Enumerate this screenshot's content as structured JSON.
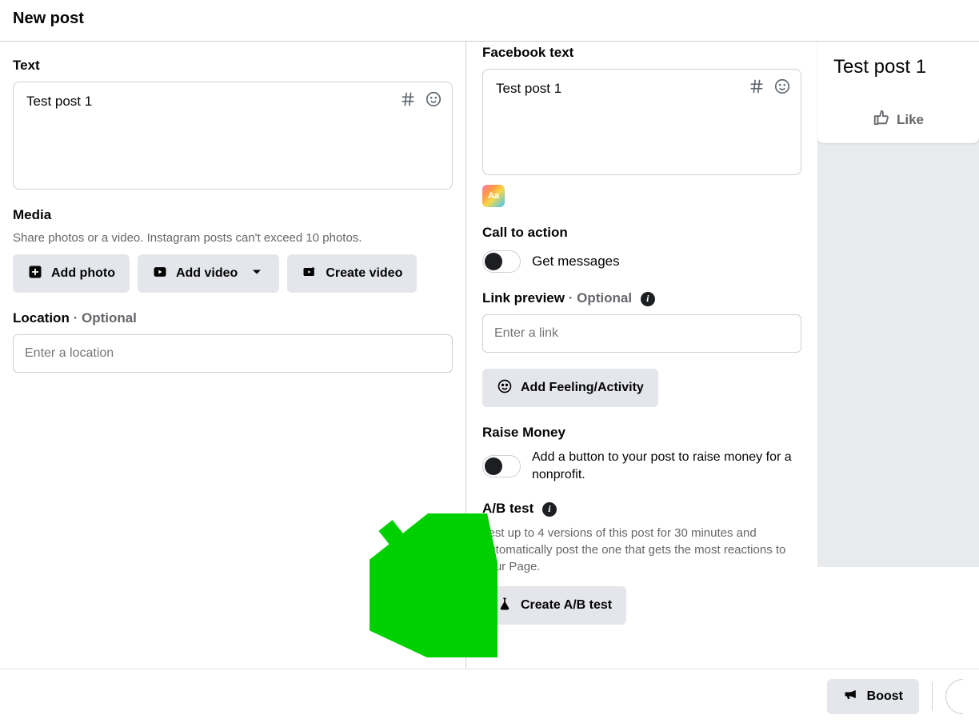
{
  "header": {
    "title": "New post"
  },
  "left": {
    "text_label": "Text",
    "text_value": "Test post 1",
    "media_label": "Media",
    "media_sub": "Share photos or a video. Instagram posts can't exceed 10 photos.",
    "add_photo": "Add photo",
    "add_video": "Add video",
    "create_video": "Create video",
    "location_label": "Location",
    "optional": "Optional",
    "location_placeholder": "Enter a location"
  },
  "mid": {
    "fb_text_label": "Facebook text",
    "fb_text_value": "Test post 1",
    "bg_chip": "Aa",
    "cta_label": "Call to action",
    "cta_option": "Get messages",
    "link_label": "Link preview",
    "link_optional": "Optional",
    "link_placeholder": "Enter a link",
    "feeling_btn": "Add Feeling/Activity",
    "raise_label": "Raise Money",
    "raise_desc": "Add a button to your post to raise money for a nonprofit.",
    "ab_label": "A/B test",
    "ab_desc": "Test up to 4 versions of this post for 30 minutes and automatically post the one that gets the most reactions to your Page.",
    "ab_btn": "Create A/B test"
  },
  "preview": {
    "title": "Test post 1",
    "like": "Like"
  },
  "bottom": {
    "boost": "Boost"
  }
}
